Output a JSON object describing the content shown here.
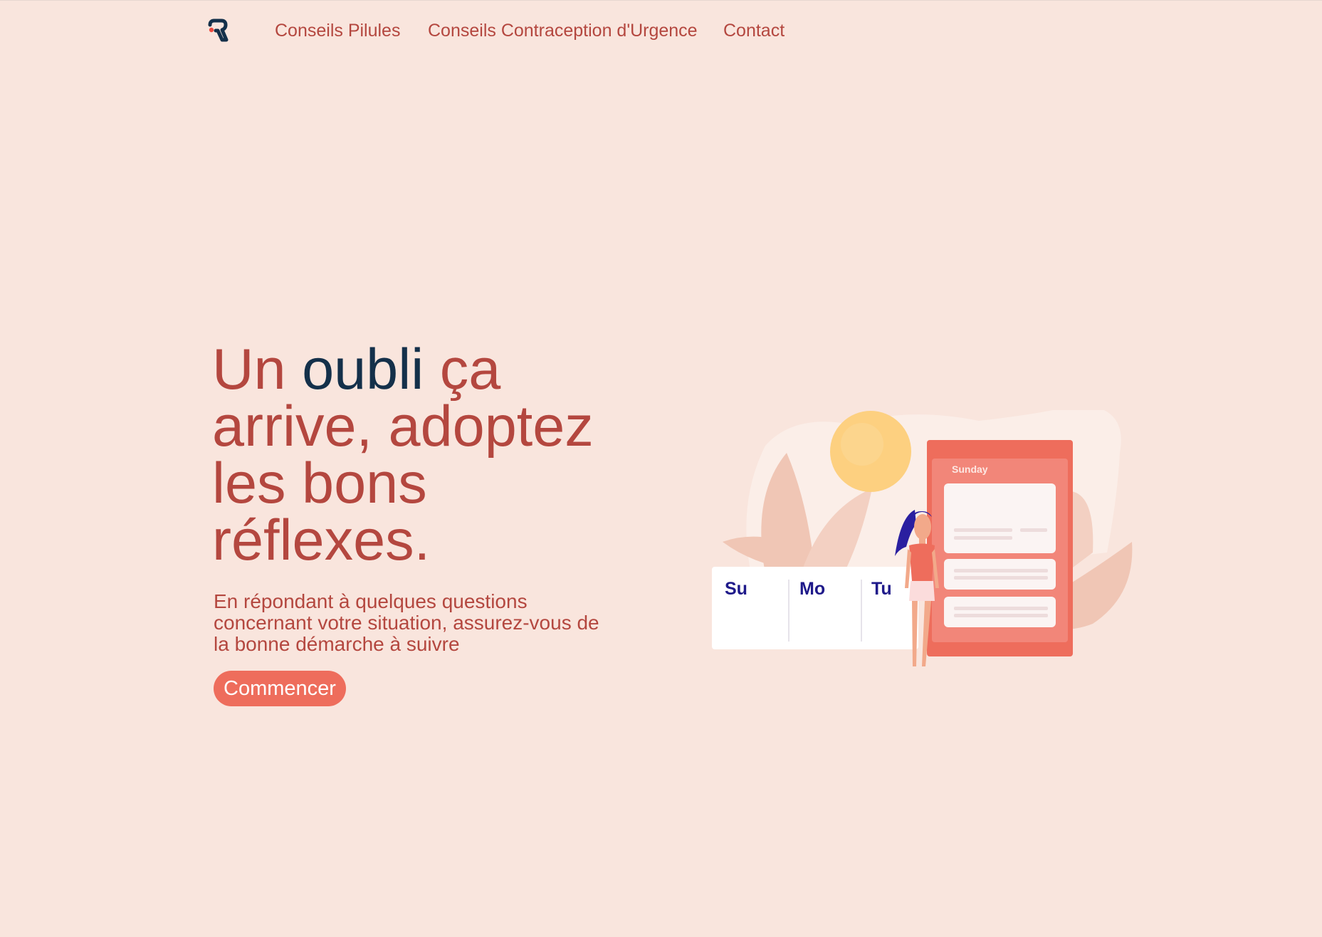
{
  "nav": {
    "logo_icon": "brand-logo-icon",
    "links": [
      {
        "label": "Conseils Pilules"
      },
      {
        "label": "Conseils Contraception d'Urgence"
      },
      {
        "label": "Contact"
      }
    ]
  },
  "hero": {
    "title_part1": "Un ",
    "title_accent": "oubli",
    "title_part2": " ça arrive, adoptez les bons réflexes.",
    "subtitle": "En répondant à quelques questions concernant votre situation, assurez-vous de la bonne démarche à suivre",
    "cta_label": "Commencer"
  },
  "illustration": {
    "weekdays": [
      "Su",
      "Mo",
      "Tu"
    ],
    "card_label": "Sunday"
  },
  "colors": {
    "background": "#f9e5dd",
    "primary_text": "#b4473f",
    "accent_text": "#14304a",
    "button": "#ee6d5c",
    "phone": "#ee6d5c",
    "sun": "#fdd080",
    "weekday_text": "#1f1a8a"
  }
}
